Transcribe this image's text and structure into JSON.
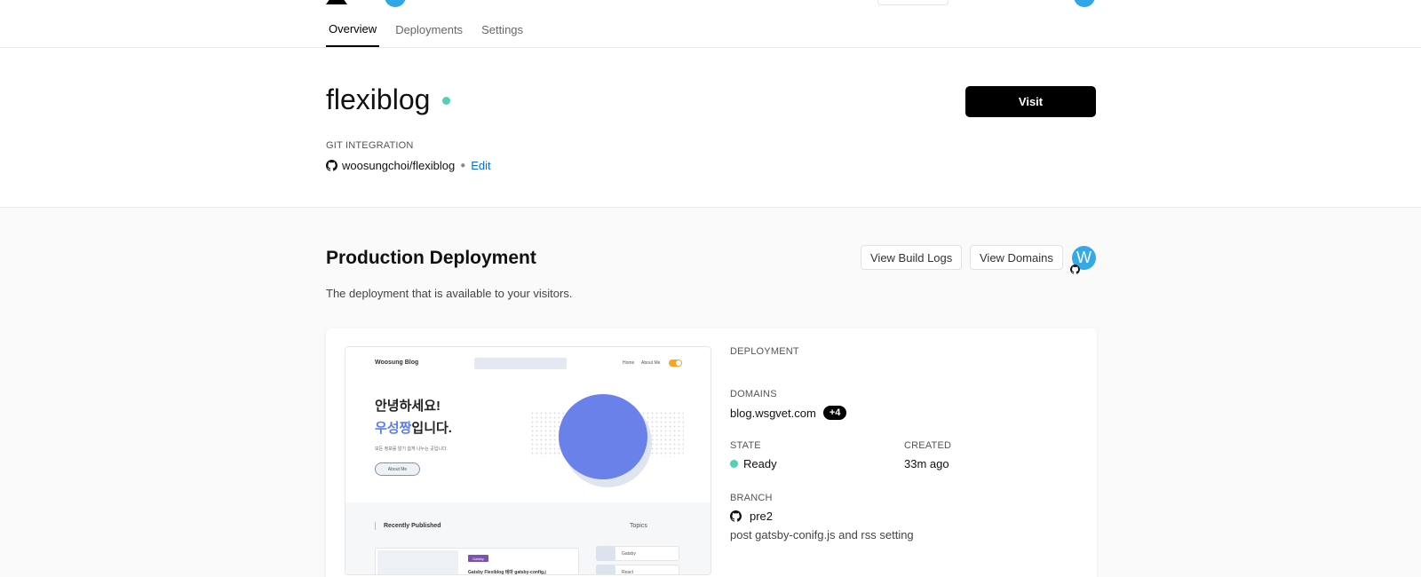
{
  "tabs": [
    {
      "label": "Overview",
      "active": true
    },
    {
      "label": "Deployments",
      "active": false
    },
    {
      "label": "Settings",
      "active": false
    }
  ],
  "project": {
    "name": "flexiblog",
    "status_color": "#4fd1b5",
    "visit_label": "Visit",
    "git_label": "GIT INTEGRATION",
    "git_icon": "github-icon",
    "repo": "woosungchoi/flexiblog",
    "edit_label": "Edit"
  },
  "production": {
    "title": "Production Deployment",
    "subtitle": "The deployment that is available to your visitors.",
    "view_logs_label": "View Build Logs",
    "view_domains_label": "View Domains",
    "avatar_initial": "W"
  },
  "preview": {
    "brand": "Woosung Blog",
    "nav_home": "Home",
    "nav_about": "About Me",
    "headline_1": "안녕하세요!",
    "headline_2_accent": "우성짱",
    "headline_2_rest": "입니다.",
    "tagline": "모든 정보를 알기 쉽게 나누는 곳입니다.",
    "about_btn": "About Me",
    "recent_label": "Recently Published",
    "topics_label": "Topics",
    "post_badge": "Gatsby",
    "post_title": "Gatsby Flexiblog 테마 gatsby-config.j",
    "topic_1": "Gatsby",
    "topic_2": "React"
  },
  "deployment": {
    "section_label": "DEPLOYMENT",
    "domains_label": "DOMAINS",
    "domain": "blog.wsgvet.com",
    "extra_domains": "+4",
    "state_label": "STATE",
    "state": "Ready",
    "created_label": "CREATED",
    "created": "33m ago",
    "branch_label": "BRANCH",
    "branch": "pre2",
    "commit_message": "post gatsby-conifg.js and rss setting"
  }
}
